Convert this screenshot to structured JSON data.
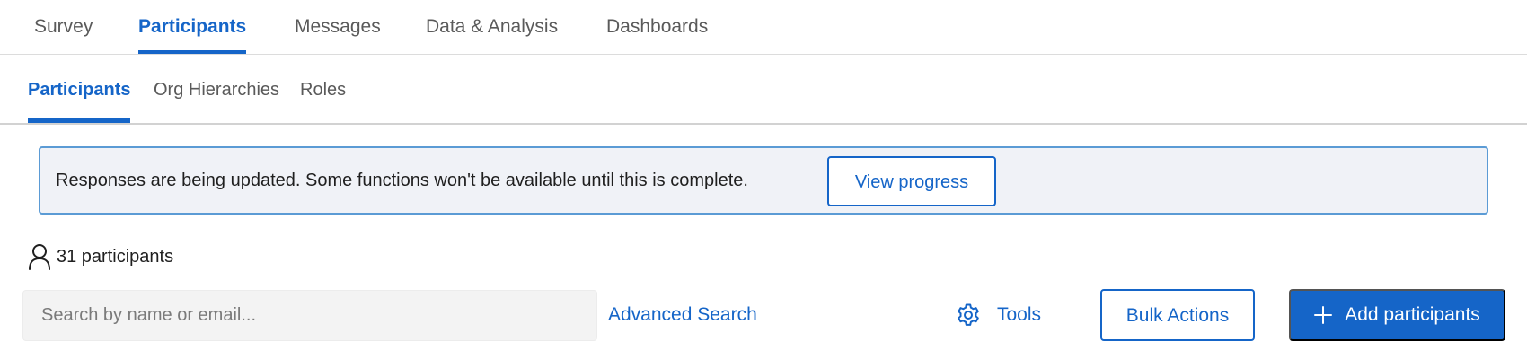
{
  "top_tabs": {
    "items": [
      {
        "label": "Survey"
      },
      {
        "label": "Participants",
        "active": true
      },
      {
        "label": "Messages"
      },
      {
        "label": "Data & Analysis"
      },
      {
        "label": "Dashboards"
      }
    ]
  },
  "sub_tabs": {
    "items": [
      {
        "label": "Participants",
        "active": true
      },
      {
        "label": "Org Hierarchies"
      },
      {
        "label": "Roles"
      }
    ]
  },
  "banner": {
    "message": "Responses are being updated. Some functions won't be available until this is complete.",
    "button_label": "View progress"
  },
  "participants": {
    "count_label": "31 participants",
    "icon": "person-icon"
  },
  "toolbar": {
    "search_placeholder": "Search by name or email...",
    "advanced_search_label": "Advanced Search",
    "tools_label": "Tools",
    "tools_icon": "gear-icon",
    "bulk_actions_label": "Bulk Actions",
    "add_participants_label": "Add participants",
    "add_icon": "plus-icon"
  },
  "colors": {
    "accent": "#1565c8",
    "banner_bg": "#f0f2f7",
    "banner_border": "#5b9bd5"
  }
}
